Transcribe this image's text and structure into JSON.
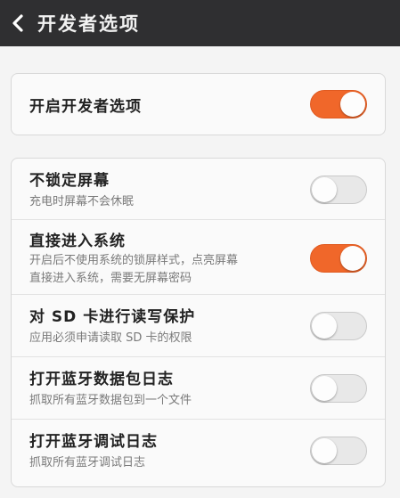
{
  "header": {
    "title": "开发者选项",
    "back_icon": "chevron-left-icon"
  },
  "colors": {
    "accent": "#f0672a",
    "titlebar": "#2f2f31"
  },
  "main_option": {
    "label": "开启开发者选项",
    "enabled": true
  },
  "options": [
    {
      "label": "不锁定屏幕",
      "desc": [
        "充电时屏幕不会休眠"
      ],
      "enabled": false
    },
    {
      "label": "直接进入系统",
      "desc": [
        "开启后不使用系统的锁屏样式，点亮屏幕",
        "直接进入系统，需要无屏幕密码"
      ],
      "enabled": true
    },
    {
      "label": "对 SD 卡进行读写保护",
      "desc": [
        "应用必须申请读取 SD 卡的权限"
      ],
      "enabled": false
    },
    {
      "label": "打开蓝牙数据包日志",
      "desc": [
        "抓取所有蓝牙数据包到一个文件"
      ],
      "enabled": false
    },
    {
      "label": "打开蓝牙调试日志",
      "desc": [
        "抓取所有蓝牙调试日志"
      ],
      "enabled": false
    }
  ]
}
